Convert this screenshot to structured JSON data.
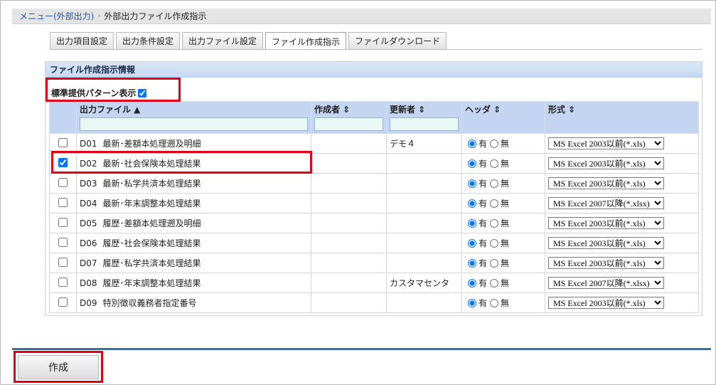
{
  "breadcrumb": {
    "link": "メニュー(外部出力)",
    "separator": "›",
    "current": "外部出力ファイル作成指示"
  },
  "tabs": [
    {
      "label": "出力項目設定",
      "active": false
    },
    {
      "label": "出力条件設定",
      "active": false
    },
    {
      "label": "出力ファイル設定",
      "active": false
    },
    {
      "label": "ファイル作成指示",
      "active": true
    },
    {
      "label": "ファイルダウンロード",
      "active": false
    }
  ],
  "panel": {
    "title": "ファイル作成指示情報",
    "pattern_label": "標準提供パターン表示",
    "pattern_checked": true
  },
  "table": {
    "columns": [
      "出力ファイル ▲",
      "作成者 ⇕",
      "更新者 ⇕",
      "ヘッダ ⇕",
      "形式 ⇕"
    ],
    "header_yes": "有",
    "header_no": "無",
    "rows": [
      {
        "checked": false,
        "code": "D01",
        "name": "最新･差額本処理遡及明細",
        "creator": "",
        "updater": "デモ４",
        "header": "yes",
        "format": "MS Excel 2003以前(*.xls)"
      },
      {
        "checked": true,
        "code": "D02",
        "name": "最新･社会保険本処理結果",
        "creator": "",
        "updater": "",
        "header": "yes",
        "format": "MS Excel 2003以前(*.xls)"
      },
      {
        "checked": false,
        "code": "D03",
        "name": "最新･私学共済本処理結果",
        "creator": "",
        "updater": "",
        "header": "yes",
        "format": "MS Excel 2003以前(*.xls)"
      },
      {
        "checked": false,
        "code": "D04",
        "name": "最新･年末調整本処理結果",
        "creator": "",
        "updater": "",
        "header": "yes",
        "format": "MS Excel 2007以降(*.xlsx)"
      },
      {
        "checked": false,
        "code": "D05",
        "name": "履歴･差額本処理遡及明細",
        "creator": "",
        "updater": "",
        "header": "yes",
        "format": "MS Excel 2003以前(*.xls)"
      },
      {
        "checked": false,
        "code": "D06",
        "name": "履歴･社会保険本処理結果",
        "creator": "",
        "updater": "",
        "header": "yes",
        "format": "MS Excel 2003以前(*.xls)"
      },
      {
        "checked": false,
        "code": "D07",
        "name": "履歴･私学共済本処理結果",
        "creator": "",
        "updater": "",
        "header": "yes",
        "format": "MS Excel 2003以前(*.xls)"
      },
      {
        "checked": false,
        "code": "D08",
        "name": "履歴･年末調整本処理結果",
        "creator": "",
        "updater": "カスタマセンタ",
        "header": "yes",
        "format": "MS Excel 2007以降(*.xlsx)"
      },
      {
        "checked": false,
        "code": "D09",
        "name": "特別徴収義務者指定番号",
        "creator": "",
        "updater": "",
        "header": "yes",
        "format": "MS Excel 2003以前(*.xls)"
      }
    ]
  },
  "footer": {
    "create_label": "作成"
  },
  "colors": {
    "panel_header": "#c7daf3",
    "table_header": "#c3d5f0",
    "highlight": "#e0001a",
    "footer_line": "#3a6ea5"
  }
}
